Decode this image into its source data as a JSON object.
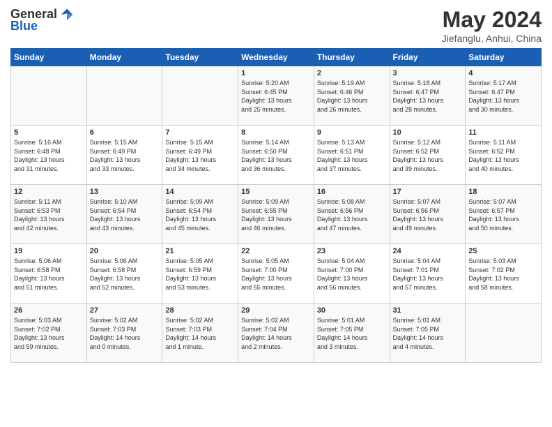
{
  "header": {
    "logo_general": "General",
    "logo_blue": "Blue",
    "title": "May 2024",
    "location": "Jiefanglu, Anhui, China"
  },
  "days_of_week": [
    "Sunday",
    "Monday",
    "Tuesday",
    "Wednesday",
    "Thursday",
    "Friday",
    "Saturday"
  ],
  "weeks": [
    [
      {
        "day": "",
        "info": ""
      },
      {
        "day": "",
        "info": ""
      },
      {
        "day": "",
        "info": ""
      },
      {
        "day": "1",
        "info": "Sunrise: 5:20 AM\nSunset: 6:45 PM\nDaylight: 13 hours\nand 25 minutes."
      },
      {
        "day": "2",
        "info": "Sunrise: 5:19 AM\nSunset: 6:46 PM\nDaylight: 13 hours\nand 26 minutes."
      },
      {
        "day": "3",
        "info": "Sunrise: 5:18 AM\nSunset: 6:47 PM\nDaylight: 13 hours\nand 28 minutes."
      },
      {
        "day": "4",
        "info": "Sunrise: 5:17 AM\nSunset: 6:47 PM\nDaylight: 13 hours\nand 30 minutes."
      }
    ],
    [
      {
        "day": "5",
        "info": "Sunrise: 5:16 AM\nSunset: 6:48 PM\nDaylight: 13 hours\nand 31 minutes."
      },
      {
        "day": "6",
        "info": "Sunrise: 5:15 AM\nSunset: 6:49 PM\nDaylight: 13 hours\nand 33 minutes."
      },
      {
        "day": "7",
        "info": "Sunrise: 5:15 AM\nSunset: 6:49 PM\nDaylight: 13 hours\nand 34 minutes."
      },
      {
        "day": "8",
        "info": "Sunrise: 5:14 AM\nSunset: 6:50 PM\nDaylight: 13 hours\nand 36 minutes."
      },
      {
        "day": "9",
        "info": "Sunrise: 5:13 AM\nSunset: 6:51 PM\nDaylight: 13 hours\nand 37 minutes."
      },
      {
        "day": "10",
        "info": "Sunrise: 5:12 AM\nSunset: 6:52 PM\nDaylight: 13 hours\nand 39 minutes."
      },
      {
        "day": "11",
        "info": "Sunrise: 5:11 AM\nSunset: 6:52 PM\nDaylight: 13 hours\nand 40 minutes."
      }
    ],
    [
      {
        "day": "12",
        "info": "Sunrise: 5:11 AM\nSunset: 6:53 PM\nDaylight: 13 hours\nand 42 minutes."
      },
      {
        "day": "13",
        "info": "Sunrise: 5:10 AM\nSunset: 6:54 PM\nDaylight: 13 hours\nand 43 minutes."
      },
      {
        "day": "14",
        "info": "Sunrise: 5:09 AM\nSunset: 6:54 PM\nDaylight: 13 hours\nand 45 minutes."
      },
      {
        "day": "15",
        "info": "Sunrise: 5:09 AM\nSunset: 6:55 PM\nDaylight: 13 hours\nand 46 minutes."
      },
      {
        "day": "16",
        "info": "Sunrise: 5:08 AM\nSunset: 6:56 PM\nDaylight: 13 hours\nand 47 minutes."
      },
      {
        "day": "17",
        "info": "Sunrise: 5:07 AM\nSunset: 6:56 PM\nDaylight: 13 hours\nand 49 minutes."
      },
      {
        "day": "18",
        "info": "Sunrise: 5:07 AM\nSunset: 6:57 PM\nDaylight: 13 hours\nand 50 minutes."
      }
    ],
    [
      {
        "day": "19",
        "info": "Sunrise: 5:06 AM\nSunset: 6:58 PM\nDaylight: 13 hours\nand 51 minutes."
      },
      {
        "day": "20",
        "info": "Sunrise: 5:06 AM\nSunset: 6:58 PM\nDaylight: 13 hours\nand 52 minutes."
      },
      {
        "day": "21",
        "info": "Sunrise: 5:05 AM\nSunset: 6:59 PM\nDaylight: 13 hours\nand 53 minutes."
      },
      {
        "day": "22",
        "info": "Sunrise: 5:05 AM\nSunset: 7:00 PM\nDaylight: 13 hours\nand 55 minutes."
      },
      {
        "day": "23",
        "info": "Sunrise: 5:04 AM\nSunset: 7:00 PM\nDaylight: 13 hours\nand 56 minutes."
      },
      {
        "day": "24",
        "info": "Sunrise: 5:04 AM\nSunset: 7:01 PM\nDaylight: 13 hours\nand 57 minutes."
      },
      {
        "day": "25",
        "info": "Sunrise: 5:03 AM\nSunset: 7:02 PM\nDaylight: 13 hours\nand 58 minutes."
      }
    ],
    [
      {
        "day": "26",
        "info": "Sunrise: 5:03 AM\nSunset: 7:02 PM\nDaylight: 13 hours\nand 59 minutes."
      },
      {
        "day": "27",
        "info": "Sunrise: 5:02 AM\nSunset: 7:03 PM\nDaylight: 14 hours\nand 0 minutes."
      },
      {
        "day": "28",
        "info": "Sunrise: 5:02 AM\nSunset: 7:03 PM\nDaylight: 14 hours\nand 1 minute."
      },
      {
        "day": "29",
        "info": "Sunrise: 5:02 AM\nSunset: 7:04 PM\nDaylight: 14 hours\nand 2 minutes."
      },
      {
        "day": "30",
        "info": "Sunrise: 5:01 AM\nSunset: 7:05 PM\nDaylight: 14 hours\nand 3 minutes."
      },
      {
        "day": "31",
        "info": "Sunrise: 5:01 AM\nSunset: 7:05 PM\nDaylight: 14 hours\nand 4 minutes."
      },
      {
        "day": "",
        "info": ""
      }
    ]
  ]
}
